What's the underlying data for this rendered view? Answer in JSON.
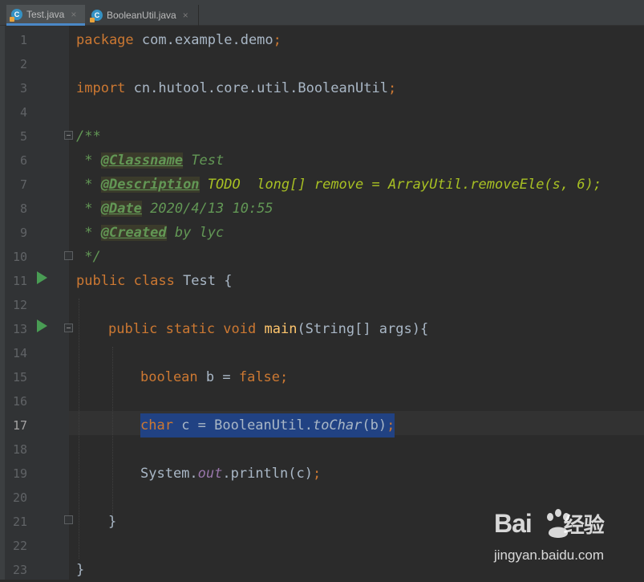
{
  "tabs": [
    {
      "label": "Test.java",
      "icon": "java-class-icon",
      "active": true
    },
    {
      "label": "BooleanUtil.java",
      "icon": "java-class-icon",
      "active": false
    }
  ],
  "close_glyph": "×",
  "line_numbers": [
    "1",
    "2",
    "3",
    "4",
    "5",
    "6",
    "7",
    "8",
    "9",
    "10",
    "11",
    "12",
    "13",
    "14",
    "15",
    "16",
    "17",
    "18",
    "19",
    "20",
    "21",
    "22",
    "23"
  ],
  "current_line": "17",
  "code": {
    "l1": {
      "kw": "package",
      "rest": " com.example.demo",
      "semi": ";"
    },
    "l3": {
      "kw": "import",
      "rest": " cn.hutool.core.util.BooleanUtil",
      "semi": ";"
    },
    "l5": {
      "text": "/**"
    },
    "l6": {
      "star": " * ",
      "tag": "@Classname",
      "rest": " Test"
    },
    "l7": {
      "star": " * ",
      "tag": "@Description",
      "rest": " ",
      "todo": "TODO  long[] remove = ArrayUtil.removeEle(s, 6);"
    },
    "l8": {
      "star": " * ",
      "tag": "@Date",
      "rest": " 2020/4/13 10:55"
    },
    "l9": {
      "star": " * ",
      "tag": "@Created",
      "rest": " by lyc"
    },
    "l10": {
      "text": " */"
    },
    "l11": {
      "kw": "public class",
      "rest": " Test {"
    },
    "l13": {
      "kw": "public static void",
      "fn": "main",
      "rest": "(String[] args){"
    },
    "l15": {
      "kw": "boolean",
      "mid": " b = ",
      "kw2": "false",
      "semi": ";"
    },
    "l17": {
      "kw": "char",
      "mid": " c = BooleanUtil.",
      "call": "toChar",
      "arg": "(b)",
      "semi": ";"
    },
    "l19": {
      "pre": "System.",
      "field": "out",
      "post": ".println(c)",
      "semi": ";"
    },
    "l21": {
      "text": "}"
    },
    "l23": {
      "text": "}"
    }
  },
  "watermark": {
    "logo": "Bai",
    "logo2": "经验",
    "url": "jingyan.baidu.com"
  },
  "colors": {
    "keyword": "#cc7832",
    "comment": "#629755",
    "method": "#ffc66d",
    "static_field": "#9876aa",
    "selection": "#214283",
    "run": "#499c54"
  }
}
